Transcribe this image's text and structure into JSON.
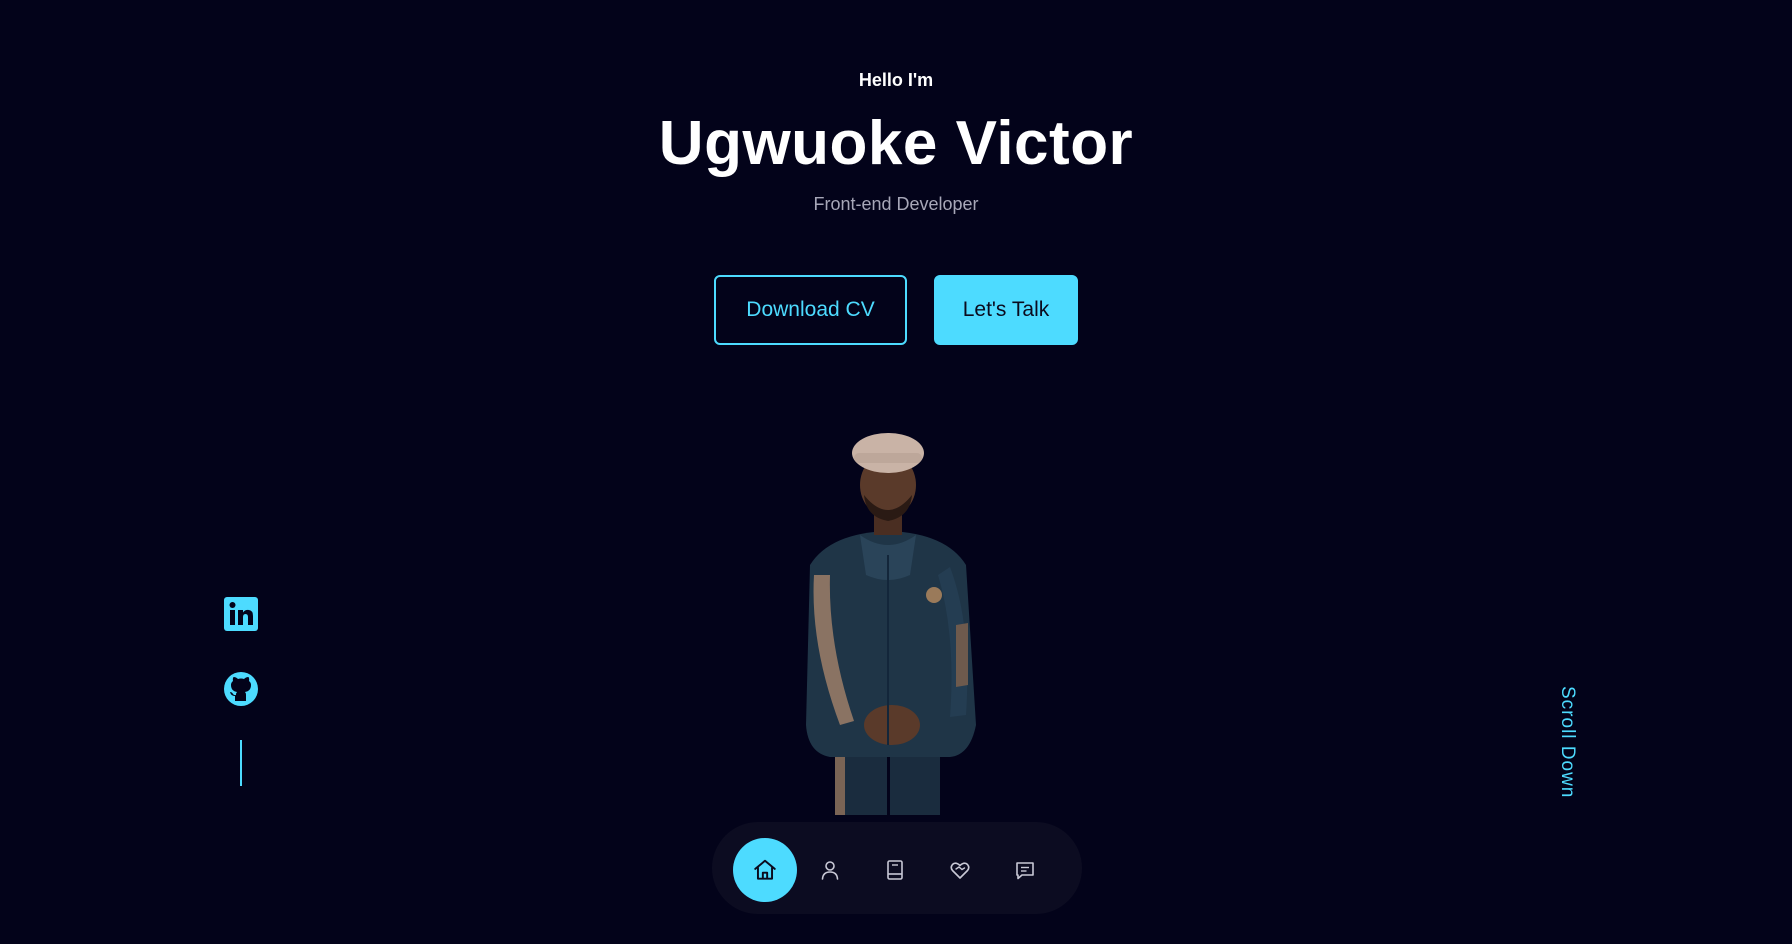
{
  "hero": {
    "greeting": "Hello I'm",
    "name": "Ugwuoke Victor",
    "role": "Front-end Developer",
    "download_label": "Download CV",
    "talk_label": "Let's Talk"
  },
  "socials": [
    {
      "name": "linkedin",
      "icon": "linkedin-icon"
    },
    {
      "name": "github",
      "icon": "github-icon"
    }
  ],
  "scroll_label": "Scroll Down",
  "nav": {
    "items": [
      {
        "name": "home",
        "icon": "home-icon",
        "active": true
      },
      {
        "name": "about",
        "icon": "user-icon",
        "active": false
      },
      {
        "name": "experience",
        "icon": "book-icon",
        "active": false
      },
      {
        "name": "services",
        "icon": "heart-handshake-icon",
        "active": false
      },
      {
        "name": "contact",
        "icon": "message-icon",
        "active": false
      }
    ]
  },
  "colors": {
    "background": "#03031a",
    "accent": "#4ddbff",
    "muted_text": "#a7a7b8"
  }
}
